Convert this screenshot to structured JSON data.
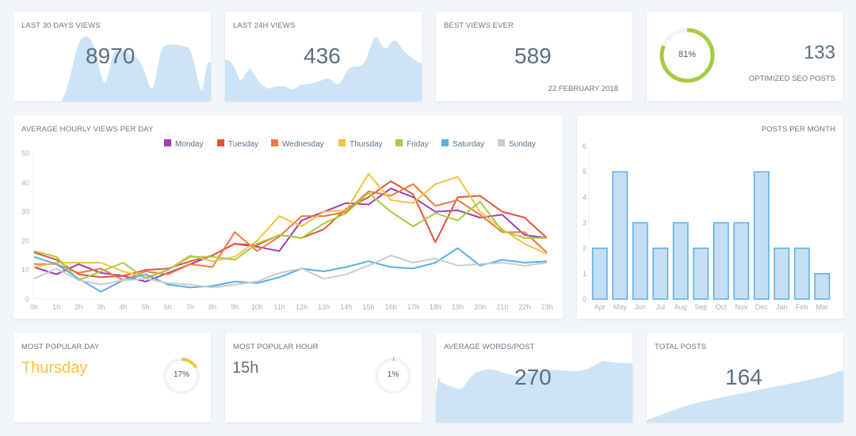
{
  "cards": {
    "last30": {
      "title": "LAST 30 DAYS VIEWS",
      "value": "8970"
    },
    "last24": {
      "title": "LAST 24H VIEWS",
      "value": "436"
    },
    "best": {
      "title": "BEST VIEWS EVER",
      "value": "589",
      "date": "22 FEBRUARY 2018"
    },
    "seo": {
      "percent_label": "81%",
      "percent": 81,
      "value": "133",
      "label": "OPTIMIZED SEO POSTS",
      "color": "#a6cc3f"
    },
    "popular_day": {
      "title": "MOST POPULAR DAY",
      "value": "Thursday",
      "percent_label": "17%",
      "percent": 17,
      "color": "#f5c242"
    },
    "popular_hour": {
      "title": "MOST POPULAR HOUR",
      "value": "15h",
      "percent_label": "1%",
      "percent": 1,
      "color": "#5aaee8"
    },
    "avg_words": {
      "title": "AVERAGE WORDS/POST",
      "value": "270"
    },
    "total_posts": {
      "title": "TOTAL POSTS",
      "value": "164"
    }
  },
  "chart_data": [
    {
      "type": "line",
      "title": "AVERAGE HOURLY VIEWS PER DAY",
      "legend_position": "top-right",
      "ylim": [
        0,
        50
      ],
      "yticks": [
        "0",
        "10",
        "20",
        "30",
        "40",
        "50"
      ],
      "categories": [
        "0h",
        "1h",
        "2h",
        "3h",
        "4h",
        "5h",
        "6h",
        "7h",
        "8h",
        "9h",
        "10h",
        "11h",
        "12h",
        "13h",
        "14h",
        "15h",
        "16h",
        "17h",
        "18h",
        "19h",
        "20h",
        "21h",
        "22h",
        "23h"
      ],
      "series": [
        {
          "name": "Monday",
          "color": "#a33bb8",
          "values": [
            11,
            8.5,
            12,
            9,
            8,
            6,
            9,
            12,
            15,
            19,
            18,
            16.5,
            27,
            30,
            33,
            32.5,
            38,
            35,
            30,
            30.5,
            28,
            29,
            22,
            21
          ]
        },
        {
          "name": "Tuesday",
          "color": "#e5553a",
          "values": [
            16,
            13.5,
            8.5,
            7.5,
            8,
            10,
            10.5,
            13,
            15,
            19,
            18.5,
            22,
            21,
            24,
            31,
            35,
            40.5,
            36,
            19.5,
            35,
            35.5,
            30,
            28,
            21
          ]
        },
        {
          "name": "Wednesday",
          "color": "#ea7b3f",
          "values": [
            12,
            12,
            9,
            10.5,
            6.5,
            9.5,
            8.5,
            12,
            11,
            23,
            16.5,
            21.5,
            28.5,
            28.5,
            30,
            37,
            35.5,
            39.5,
            32,
            34,
            29,
            23,
            23,
            16
          ]
        },
        {
          "name": "Thursday",
          "color": "#f5c242",
          "values": [
            11,
            12.5,
            12.5,
            12.5,
            9.5,
            7.5,
            10,
            15,
            13,
            14.5,
            20,
            28.5,
            25,
            30,
            30.5,
            43,
            34,
            33,
            39.5,
            42,
            30,
            24,
            19,
            15.5
          ]
        },
        {
          "name": "Friday",
          "color": "#a6cc3f",
          "values": [
            16.5,
            14.5,
            6.5,
            9.5,
            12.5,
            7,
            10,
            14.5,
            14.5,
            13.5,
            19,
            22,
            21,
            26,
            29.5,
            36.5,
            30,
            25,
            29.5,
            27,
            33.5,
            23.5,
            21,
            21
          ]
        },
        {
          "name": "Saturday",
          "color": "#5aaee8",
          "values": [
            14.5,
            12,
            7,
            2.5,
            6.5,
            8.5,
            5,
            4,
            4.5,
            6,
            5.5,
            7.5,
            10.5,
            9.5,
            11,
            13,
            11,
            10.5,
            12.5,
            17.5,
            11.5,
            13.5,
            12.5,
            13
          ]
        },
        {
          "name": "Sunday",
          "color": "#cccccc",
          "values": [
            7,
            10.5,
            6.5,
            5,
            6.5,
            7,
            5.5,
            5,
            4,
            5,
            6,
            9,
            10.5,
            7,
            8.5,
            11.5,
            15,
            12.5,
            14,
            11.5,
            12,
            12.5,
            11.5,
            12.5
          ]
        }
      ]
    },
    {
      "type": "bar",
      "title": "POSTS PER MONTH",
      "ylim": [
        0,
        6
      ],
      "yticks": [
        "0",
        "1",
        "2",
        "3",
        "4",
        "5",
        "6"
      ],
      "categories": [
        "Apr",
        "May",
        "Jun",
        "Jul",
        "Aug",
        "Sep",
        "Oct",
        "Nov",
        "Dec",
        "Jan",
        "Feb",
        "Mar"
      ],
      "values": [
        2,
        5,
        3,
        2,
        3,
        2,
        3,
        3,
        5,
        2,
        2,
        1
      ],
      "color": "#5aaee8"
    }
  ]
}
